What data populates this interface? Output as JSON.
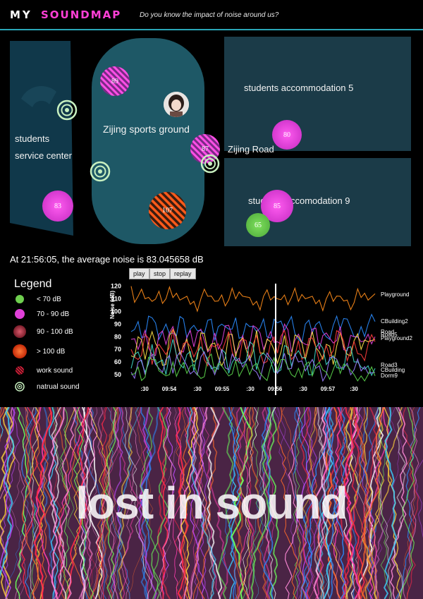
{
  "header": {
    "logo_my": "MY",
    "logo_soundmap": "SOUNDMAP",
    "tagline": "Do you know the impact of noise around us?"
  },
  "map": {
    "labels": {
      "service_center_1": "students",
      "service_center_2": "service center",
      "sports_ground": "Zijing sports ground",
      "accommodation_5": "students accommodation 5",
      "zijing_road": "Zijing Road",
      "accommodation_9": "students accomodation 9"
    },
    "bubbles": {
      "b89": "89",
      "b83": "83",
      "b107": "107",
      "b87": "87",
      "b80": "80",
      "b85": "85",
      "b65": "65"
    }
  },
  "status": {
    "text": "At 21:56:05, the average noise is 83.045658 dB"
  },
  "controls": {
    "play": "play",
    "stop": "stop",
    "replay": "replay"
  },
  "legend": {
    "title": "Legend",
    "items": [
      {
        "label": "< 70 dB",
        "color": "#6fcf4f"
      },
      {
        "label": "70 - 90 dB",
        "color": "#e040d8"
      },
      {
        "label": "90 - 100 dB",
        "color": "#b8364f"
      },
      {
        "label": "> 100 dB",
        "color": "#ff5a1a"
      },
      {
        "label": "work sound",
        "color": "#c0203a"
      },
      {
        "label": "natrual sound",
        "color": "#c8f0c0"
      }
    ]
  },
  "chart_data": {
    "type": "line",
    "ylabel": "Noise (dB)",
    "ylim": [
      45,
      122
    ],
    "yticks": [
      50,
      60,
      70,
      80,
      90,
      100,
      110,
      120
    ],
    "xticks": [
      ":30",
      "09:54",
      ":30",
      "09:55",
      ":30",
      "09:56",
      ":30",
      "09:57",
      ":30"
    ],
    "series": [
      {
        "name": "Playground",
        "color": "#ff8c1a",
        "values": [
          120,
          112,
          110,
          108,
          116,
          110,
          111,
          109,
          112,
          108,
          110,
          112,
          108,
          113,
          109,
          110,
          112,
          111,
          108,
          112,
          109,
          110,
          113,
          111,
          108,
          110,
          112,
          109,
          110,
          108,
          112,
          109,
          107,
          111,
          109,
          114
        ]
      },
      {
        "name": "CBuilding2",
        "color": "#2a8cff",
        "values": [
          84,
          92,
          80,
          95,
          78,
          90,
          83,
          96,
          79,
          89,
          85,
          93,
          77,
          90,
          86,
          95,
          80,
          88,
          84,
          94,
          79,
          91,
          85,
          96,
          78,
          90,
          83,
          92,
          80,
          89,
          86,
          94,
          80,
          88,
          90,
          92
        ]
      },
      {
        "name": "Road",
        "color": "#e040d8",
        "values": [
          78,
          70,
          85,
          66,
          82,
          74,
          88,
          69,
          80,
          72,
          86,
          68,
          83,
          75,
          89,
          67,
          81,
          73,
          87,
          70,
          84,
          76,
          90,
          68,
          82,
          74,
          86,
          70,
          83,
          75,
          88,
          69,
          80,
          76,
          82,
          80
        ]
      },
      {
        "name": "Road5",
        "color": "#ffe14a",
        "values": [
          65,
          80,
          62,
          84,
          70,
          58,
          86,
          66,
          78,
          60,
          83,
          69,
          75,
          57,
          82,
          64,
          79,
          61,
          85,
          67,
          76,
          59,
          81,
          65,
          80,
          62,
          84,
          68,
          74,
          58,
          83,
          66,
          77,
          70,
          76,
          78
        ]
      },
      {
        "name": "Playground2",
        "color": "#ff3c3c",
        "values": [
          70,
          62,
          82,
          58,
          74,
          66,
          86,
          60,
          76,
          64,
          80,
          57,
          72,
          68,
          84,
          61,
          78,
          63,
          81,
          59,
          75,
          67,
          85,
          62,
          77,
          65,
          79,
          60,
          73,
          69,
          83,
          61,
          76,
          66,
          74,
          76
        ]
      },
      {
        "name": "Road3",
        "color": "#3fd6c8",
        "values": [
          55,
          68,
          52,
          74,
          60,
          50,
          78,
          58,
          66,
          53,
          72,
          62,
          56,
          70,
          51,
          64,
          59,
          76,
          54,
          67,
          61,
          52,
          73,
          57,
          69,
          63,
          50,
          75,
          58,
          65,
          55,
          71,
          60,
          56,
          57,
          55
        ]
      },
      {
        "name": "CBuilding",
        "color": "#9a7cff",
        "values": [
          52,
          60,
          50,
          66,
          55,
          62,
          51,
          68,
          57,
          53,
          64,
          59,
          50,
          70,
          54,
          61,
          56,
          65,
          52,
          58,
          63,
          51,
          67,
          55,
          60,
          53,
          62,
          57,
          50,
          64,
          56,
          59,
          54,
          53,
          51,
          52
        ]
      },
      {
        "name": "Dorm9",
        "color": "#5ad24a",
        "values": [
          50,
          56,
          48,
          62,
          53,
          49,
          60,
          55,
          51,
          58,
          47,
          63,
          52,
          57,
          49,
          61,
          54,
          50,
          59,
          48,
          56,
          53,
          62,
          50,
          55,
          58,
          49,
          60,
          52,
          54,
          51,
          57,
          50,
          49,
          50,
          49
        ]
      }
    ]
  },
  "art": {
    "title": "lost in sound"
  }
}
